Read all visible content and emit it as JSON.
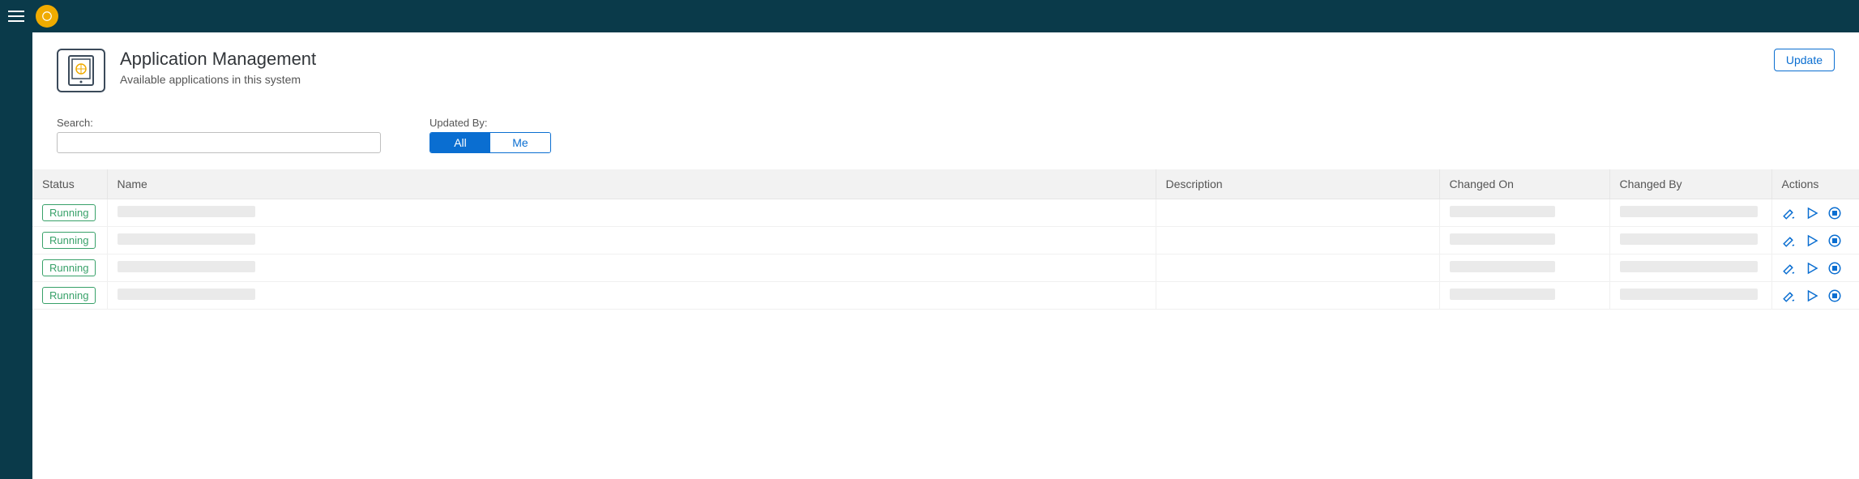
{
  "header": {
    "title": "Application Management",
    "subtitle": "Available applications in this system",
    "update_label": "Update"
  },
  "filters": {
    "search_label": "Search:",
    "search_value": "",
    "updated_by_label": "Updated By:",
    "segment_all": "All",
    "segment_me": "Me",
    "segment_active": "all"
  },
  "table": {
    "columns": {
      "status": "Status",
      "name": "Name",
      "description": "Description",
      "changed_on": "Changed On",
      "changed_by": "Changed By",
      "actions": "Actions"
    },
    "rows": [
      {
        "status": "Running",
        "name": "",
        "description": "",
        "changed_on": "",
        "changed_by": ""
      },
      {
        "status": "Running",
        "name": "",
        "description": "",
        "changed_on": "",
        "changed_by": ""
      },
      {
        "status": "Running",
        "name": "",
        "description": "",
        "changed_on": "",
        "changed_by": ""
      },
      {
        "status": "Running",
        "name": "",
        "description": "",
        "changed_on": "",
        "changed_by": ""
      }
    ]
  },
  "icons": {
    "edit": "edit-icon",
    "play": "play-icon",
    "stop": "stop-icon"
  }
}
